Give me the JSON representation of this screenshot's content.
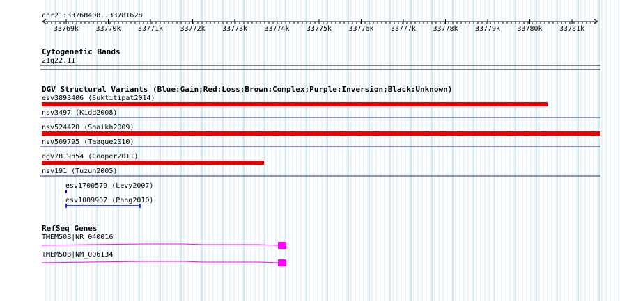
{
  "locus": {
    "label": "chr21:33768408..33781628"
  },
  "ruler": {
    "ticks": [
      "33769k",
      "33770k",
      "33771k",
      "33772k",
      "33773k",
      "33774k",
      "33775k",
      "33776k",
      "33777k",
      "33778k",
      "33779k",
      "33780k",
      "33781k"
    ]
  },
  "tracks": {
    "cytoband": {
      "title": "Cytogenetic Bands",
      "band": "21q22.11"
    },
    "dgv": {
      "title": "DGV Structural Variants (Blue:Gain;Red:Loss;Brown:Complex;Purple:Inversion;Black:Unknown)",
      "features": [
        {
          "label": "esv3893406 (Suktitipat2014)",
          "color": "#ee0000"
        },
        {
          "label": "nsv3497 (Kidd2008)",
          "color": "#000080"
        },
        {
          "label": "nsv524420 (Shaikh2009)",
          "color": "#ee0000"
        },
        {
          "label": "nsv509795 (Teague2010)",
          "color": "#000080"
        },
        {
          "label": "dgv7819n54 (Cooper2011)",
          "color": "#ee0000"
        },
        {
          "label": "nsv191 (Tuzun2005)",
          "color": "#000080"
        },
        {
          "label": "esv1700579 (Levy2007)",
          "color": "#0000cc"
        },
        {
          "label": "esv1009907 (Pang2010)",
          "color": "#0000cc"
        }
      ]
    },
    "refseq": {
      "title": "RefSeq Genes",
      "transcripts": [
        {
          "label": "TMEM50B|NR_040016",
          "color": "#ff00ff"
        },
        {
          "label": "TMEM50B|NM_006134",
          "color": "#ff00ff"
        }
      ]
    }
  }
}
